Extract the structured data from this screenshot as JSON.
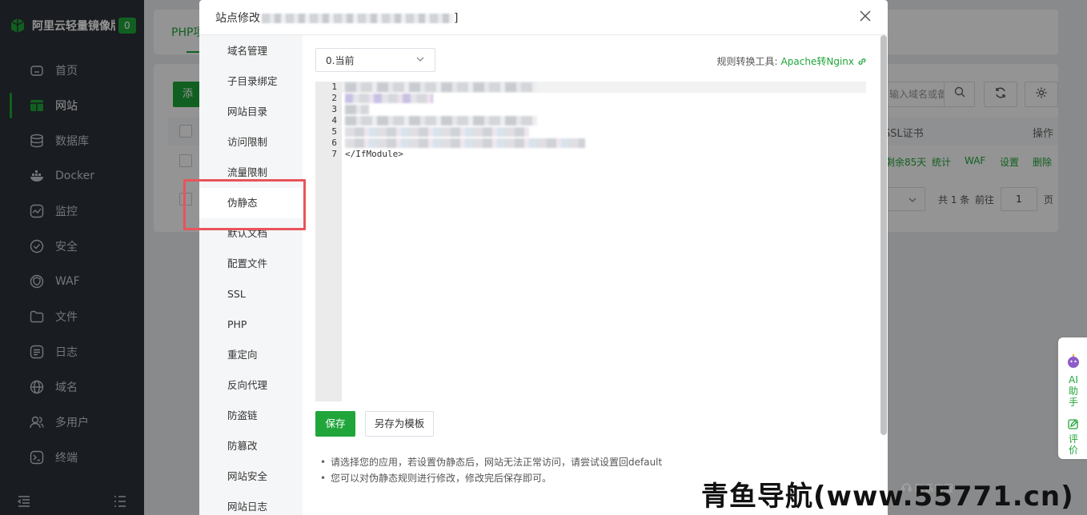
{
  "sidebar": {
    "brand_name": "阿里云轻量镜像版",
    "brand_badge": "0",
    "items": [
      {
        "label": "首页",
        "icon": "home-icon"
      },
      {
        "label": "网站",
        "icon": "website-icon",
        "active": true
      },
      {
        "label": "数据库",
        "icon": "database-icon"
      },
      {
        "label": "Docker",
        "icon": "docker-icon"
      },
      {
        "label": "监控",
        "icon": "monitor-icon"
      },
      {
        "label": "安全",
        "icon": "shield-icon"
      },
      {
        "label": "WAF",
        "icon": "waf-icon"
      },
      {
        "label": "文件",
        "icon": "folder-icon"
      },
      {
        "label": "日志",
        "icon": "log-icon"
      },
      {
        "label": "域名",
        "icon": "globe-icon"
      },
      {
        "label": "多用户",
        "icon": "users-icon"
      },
      {
        "label": "终端",
        "icon": "terminal-icon"
      }
    ]
  },
  "background": {
    "tab_label": "PHP项",
    "add_button": "添加",
    "search_placeholder": "输入域名或备",
    "col_ssl": "SSL证书",
    "col_action": "操作",
    "row_ssl": "剩余85天",
    "actions": [
      "统计",
      "WAF",
      "设置",
      "删除"
    ],
    "pager_total": "共 1 条",
    "pager_goto": "前往",
    "pager_page": "1",
    "pager_unit": "页"
  },
  "modal": {
    "title_prefix": "站点修改",
    "title_suffix": "]",
    "menu": [
      "域名管理",
      "子目录绑定",
      "网站目录",
      "访问限制",
      "流量限制",
      "伪静态",
      "默认文档",
      "配置文件",
      "SSL",
      "PHP",
      "重定向",
      "反向代理",
      "防盗链",
      "防篡改",
      "网站安全",
      "网站日志"
    ],
    "active_menu": "伪静态",
    "version_select": "0.当前",
    "tool_label": "规则转换工具:",
    "tool_link": "Apache转Nginx",
    "line_numbers": [
      "1",
      "2",
      "3",
      "4",
      "5",
      "6",
      "7"
    ],
    "line7_text": "</IfModule>",
    "save_button": "保存",
    "template_button": "另存为模板",
    "tips": [
      "请选择您的应用，若设置伪静态后，网站无法正常访问，请尝试设置回default",
      "您可以对伪静态规则进行修改，修改完后保存即可。"
    ]
  },
  "float": {
    "ai_label": "AI助手",
    "rate_label": "评价",
    "contact": "联系客服"
  },
  "watermark": "青鱼导航(www.55771.cn)",
  "colors": {
    "accent": "#20a53a",
    "sidebar_bg": "#2c3138",
    "highlight": "#e8545a"
  }
}
